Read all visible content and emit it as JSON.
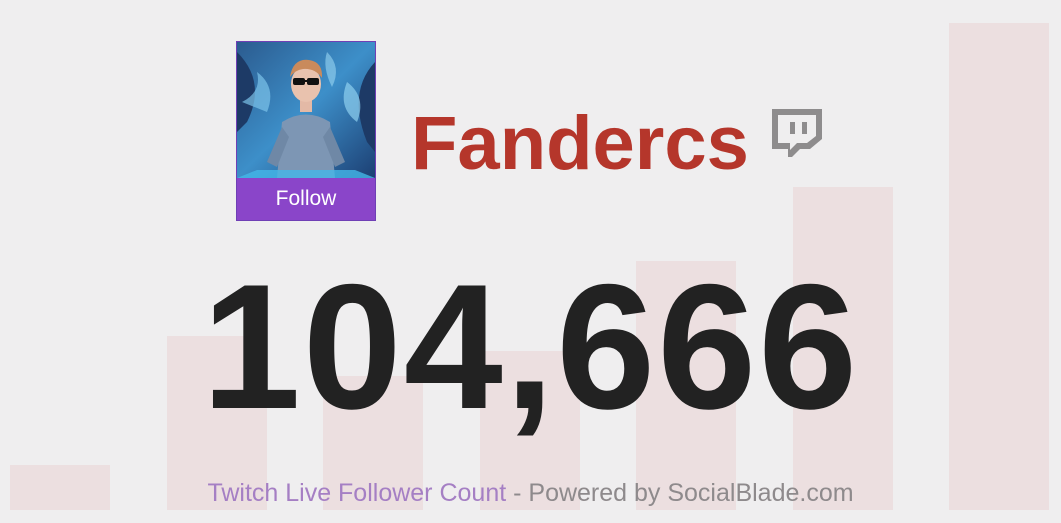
{
  "channel": {
    "name": "Fandercs",
    "follow_label": "Follow",
    "follower_count": "104,666",
    "platform_icon": "twitch-glitch-logo",
    "avatar_icon": "user-avatar-photo"
  },
  "footer": {
    "title": "Twitch Live Follower Count",
    "separator": " - ",
    "powered_by": "Powered by SocialBlade.com"
  },
  "colors": {
    "background": "#efeeef",
    "bar": "#ecdfe0",
    "name": "#b5362b",
    "count": "#222222",
    "follow_button": "#8a45c9",
    "footer_title": "#a57fc4",
    "footer_text": "#8e8a8c"
  },
  "background_bars": [
    0.09,
    0.35,
    0.27,
    0.32,
    0.5,
    0.65,
    0.98
  ]
}
